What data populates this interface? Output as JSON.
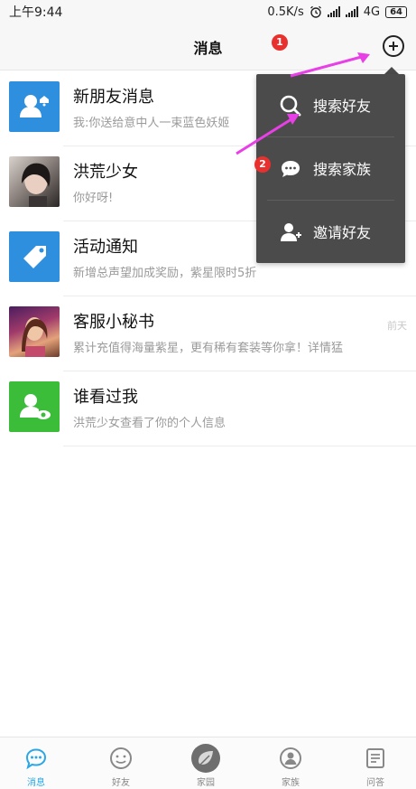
{
  "status_bar": {
    "time": "上午9:44",
    "speed": "0.5K/s",
    "network": "4G",
    "battery": "64",
    "icons": [
      "alarm-icon",
      "signal-icon",
      "signal-icon"
    ]
  },
  "header": {
    "title": "消息",
    "add_icon": "plus-circle-icon"
  },
  "messages": [
    {
      "title": "新朋友消息",
      "preview": "我:你送给意中人一束蓝色妖姬",
      "time": "",
      "icon": "new-friend-icon"
    },
    {
      "title": "洪荒少女",
      "preview": "你好呀!",
      "time": "",
      "icon": "avatar-photo"
    },
    {
      "title": "活动通知",
      "preview": "新增总声望加成奖励，紫星限时5折",
      "time": "",
      "icon": "tag-icon"
    },
    {
      "title": "客服小秘书",
      "preview": "累计充值得海量紫星，更有稀有套装等你拿！详情猛",
      "time": "前天",
      "icon": "avatar-photo"
    },
    {
      "title": "谁看过我",
      "preview": "洪荒少女查看了你的个人信息",
      "time": "",
      "icon": "eye-user-icon"
    }
  ],
  "popup_menu": {
    "items": [
      {
        "label": "搜索好友",
        "icon": "search-icon"
      },
      {
        "label": "搜索家族",
        "icon": "chat-bubble-icon"
      },
      {
        "label": "邀请好友",
        "icon": "add-user-icon"
      }
    ]
  },
  "annotations": {
    "badge1": "1",
    "badge2": "2",
    "arrow_color": "#e83fe6"
  },
  "bottom_nav": {
    "items": [
      {
        "label": "消息",
        "icon": "chat-icon",
        "active": true
      },
      {
        "label": "好友",
        "icon": "smile-icon",
        "active": false
      },
      {
        "label": "家园",
        "icon": "leaf-icon",
        "active": false
      },
      {
        "label": "家族",
        "icon": "family-icon",
        "active": false
      },
      {
        "label": "问答",
        "icon": "qa-icon",
        "active": false
      }
    ]
  },
  "colors": {
    "accent": "#2aa7e6",
    "menu_bg": "#4b4b4b",
    "badge": "#e8312e"
  }
}
